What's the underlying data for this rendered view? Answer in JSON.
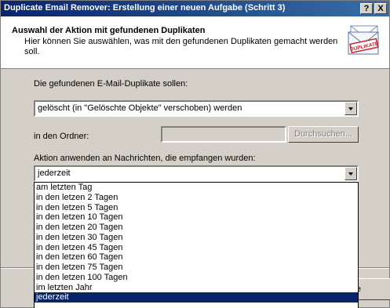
{
  "window": {
    "title": "Duplicate Email Remover: Erstellung einer neuen Aufgabe (Schritt 3)",
    "help_label": "?",
    "close_label": "X"
  },
  "header": {
    "title": "Auswahl der Aktion mit gefundenen Duplikaten",
    "description": "Hier können Sie auswählen, was mit den gefundenen Duplikaten gemacht werden soll.",
    "icon": "duplicate-envelope-icon",
    "icon_stamp_text": "DUPLIKATE"
  },
  "form": {
    "action_label": "Die gefundenen E-Mail-Duplikate sollen:",
    "action_value": "gelöscht (in \"Gelöschte Objekte\" verschoben) werden",
    "folder_label": "in den Ordner:",
    "folder_value": "",
    "browse_label": "Durchsuchen...",
    "apply_label": "Aktion anwenden an Nachrichten, die empfangen wurden:",
    "apply_value": "jederzeit"
  },
  "dropdown": {
    "items": [
      "am letzten Tag",
      "in den letzen 2 Tagen",
      "in den letzen 5 Tagen",
      "in den letzen 10 Tagen",
      "in den letzen 20 Tagen",
      "in den letzen 30 Tagen",
      "in den letzen 45 Tagen",
      "in den letzen 60 Tagen",
      "in den letzen 75 Tagen",
      "in den letzen 100 Tagen",
      "im letzten Jahr",
      "jederzeit"
    ],
    "selected_index": 11
  },
  "partial_button_label": "e",
  "colors": {
    "titlebar_start": "#0a246a",
    "titlebar_end": "#3a6ea5",
    "selection": "#0a246a",
    "face": "#d4d0c8"
  }
}
